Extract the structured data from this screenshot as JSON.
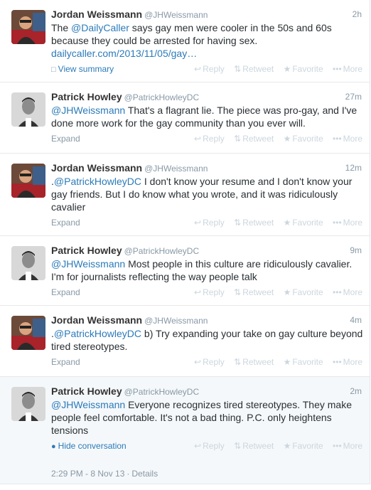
{
  "actions": {
    "reply": "Reply",
    "retweet": "Retweet",
    "favorite": "Favorite",
    "more": "More",
    "reply_icon": "reply-arrow-icon",
    "retweet_icon": "retweet-icon",
    "favorite_icon": "star-icon",
    "more_icon": "dots-icon"
  },
  "tweets": [
    {
      "author": "Jordan Weissmann",
      "handle": "@JHWeissmann",
      "time": "2h",
      "segments": [
        "The ",
        "@DailyCaller",
        " says gay men were cooler in the 50s and 60s because they could be arrested for having sex. ",
        "dailycaller.com/2013/11/05/gay…"
      ],
      "footer": "View summary"
    },
    {
      "author": "Patrick Howley",
      "handle": "@PatrickHowleyDC",
      "time": "27m",
      "segments": [
        "@JHWeissmann",
        " That's a flagrant lie. The piece was pro-gay, and I've done more work for the gay community than you ever will."
      ],
      "footer": "Expand"
    },
    {
      "author": "Jordan Weissmann",
      "handle": "@JHWeissmann",
      "time": "12m",
      "segments": [
        ".",
        "@PatrickHowleyDC",
        " I don't know your resume and I don't know your gay friends. But I do know what you wrote, and it was ridiculously cavalier"
      ],
      "footer": "Expand"
    },
    {
      "author": "Patrick Howley",
      "handle": "@PatrickHowleyDC",
      "time": "9m",
      "segments": [
        "@JHWeissmann",
        " Most people in this culture are ridiculously cavalier. I'm for journalists reflecting the way people talk"
      ],
      "footer": "Expand"
    },
    {
      "author": "Jordan Weissmann",
      "handle": "@JHWeissmann",
      "time": "4m",
      "segments": [
        ".",
        "@PatrickHowleyDC",
        " b) Try expanding your take on gay culture beyond tired stereotypes."
      ],
      "footer": "Expand"
    },
    {
      "author": "Patrick Howley",
      "handle": "@PatrickHowleyDC",
      "time": "2m",
      "segments": [
        "@JHWeissmann",
        " Everyone recognizes tired stereotypes. They make people feel comfortable. It's not a bad thing. P.C. only heightens tensions"
      ],
      "footer": "Hide conversation"
    }
  ],
  "stamp": {
    "datetime": "2:29 PM - 8 Nov 13",
    "separator": "·",
    "details": "Details"
  }
}
